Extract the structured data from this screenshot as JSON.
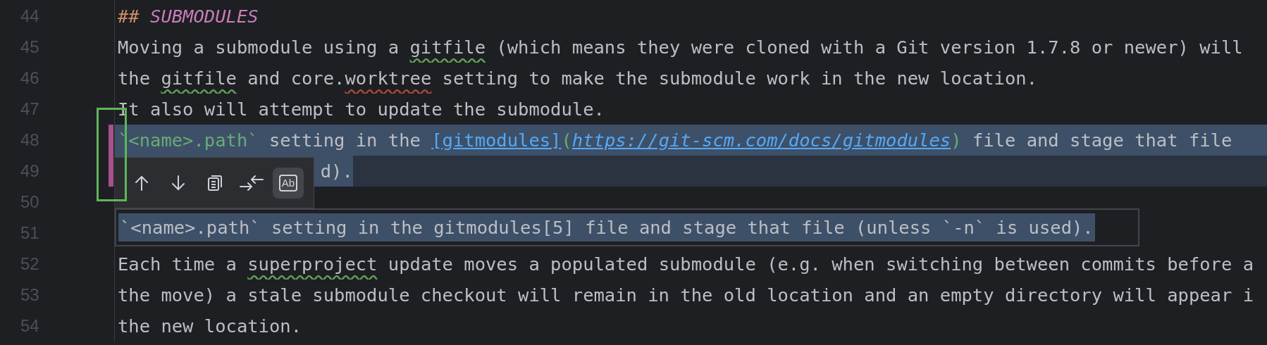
{
  "lines": [
    {
      "number": "44",
      "selected": false,
      "changed": false,
      "segments": [
        {
          "kind": "heading-mark",
          "text": "## "
        },
        {
          "kind": "heading",
          "text": "SUBMODULES"
        }
      ]
    },
    {
      "number": "45",
      "selected": false,
      "changed": false,
      "segments": [
        {
          "kind": "plain",
          "text": "Moving a submodule using a "
        },
        {
          "kind": "typo",
          "text": "gitfile"
        },
        {
          "kind": "plain",
          "text": " (which means they were cloned with a Git version 1.7.8 or newer) will"
        }
      ]
    },
    {
      "number": "46",
      "selected": false,
      "changed": false,
      "segments": [
        {
          "kind": "plain",
          "text": "the "
        },
        {
          "kind": "typo",
          "text": "gitfile"
        },
        {
          "kind": "plain",
          "text": " and core."
        },
        {
          "kind": "error",
          "text": "worktree"
        },
        {
          "kind": "plain",
          "text": " setting to make the submodule work in the new location."
        }
      ]
    },
    {
      "number": "47",
      "selected": false,
      "changed": false,
      "segments": [
        {
          "kind": "plain",
          "text": "It also will attempt to update the submodule."
        }
      ]
    },
    {
      "number": "48",
      "selected": true,
      "changed": true,
      "segments": [
        {
          "kind": "code",
          "text": "`<name>.path`"
        },
        {
          "kind": "plain",
          "text": " setting in the "
        },
        {
          "kind": "link-text",
          "text": "[gitmodules]"
        },
        {
          "kind": "paren",
          "text": "("
        },
        {
          "kind": "link-url",
          "text": "https://git-scm.com/docs/gitmodules"
        },
        {
          "kind": "paren",
          "text": ")"
        },
        {
          "kind": "plain",
          "text": " file and stage that file"
        }
      ]
    },
    {
      "number": "49",
      "selected": true,
      "changed": true,
      "covered": true,
      "segments": [
        {
          "kind": "plain",
          "text": "d)."
        }
      ]
    },
    {
      "number": "50",
      "selected": false,
      "changed": false
    },
    {
      "number": "51",
      "selected": false,
      "changed": false
    },
    {
      "number": "52",
      "selected": false,
      "changed": false,
      "segments": [
        {
          "kind": "plain",
          "text": "Each time a "
        },
        {
          "kind": "typo",
          "text": "superproject"
        },
        {
          "kind": "plain",
          "text": " update moves a populated submodule (e.g. when switching between commits before a"
        }
      ]
    },
    {
      "number": "53",
      "selected": false,
      "changed": false,
      "segments": [
        {
          "kind": "plain",
          "text": "the move) a stale submodule checkout will remain in the old location and an empty directory will appear i"
        }
      ]
    },
    {
      "number": "54",
      "selected": false,
      "changed": false,
      "segments": [
        {
          "kind": "plain",
          "text": "the new location."
        }
      ]
    }
  ],
  "toolbar": [
    {
      "kind": "up",
      "selected": false
    },
    {
      "kind": "down",
      "selected": false
    },
    {
      "kind": "copy",
      "selected": false
    },
    {
      "kind": "merge",
      "selected": false
    },
    {
      "kind": "match-case",
      "label": "Ab",
      "selected": true
    }
  ],
  "diff_preview": {
    "text": "`<name>.path` setting in the gitmodules[5] file and stage that file (unless `-n` is used).",
    "selected": true
  }
}
